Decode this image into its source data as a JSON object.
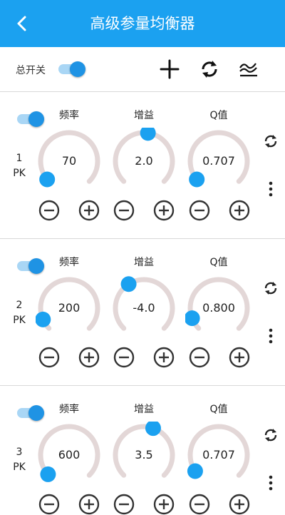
{
  "header": {
    "title": "高级参量均衡器"
  },
  "toolbar": {
    "master_label": "总开关",
    "master_on": true
  },
  "labels": {
    "freq": "频率",
    "gain": "增益",
    "q": "Q值"
  },
  "colors": {
    "accent": "#1ba1f0",
    "knob_dot": "#1ba1f0",
    "track": "#e3d7d7"
  },
  "bands": [
    {
      "index": "1",
      "type": "PK",
      "enabled": true,
      "freq": "70",
      "gain": "2.0",
      "q": "0.707",
      "freq_level": 0.02,
      "gain_level": 0.53,
      "q_level": 0.02
    },
    {
      "index": "2",
      "type": "PK",
      "enabled": true,
      "freq": "200",
      "gain": "-4.0",
      "q": "0.800",
      "freq_level": 0.08,
      "gain_level": 0.38,
      "q_level": 0.09
    },
    {
      "index": "3",
      "type": "PK",
      "enabled": true,
      "freq": "600",
      "gain": "3.5",
      "q": "0.707",
      "freq_level": 0.01,
      "gain_level": 0.57,
      "q_level": 0.04
    }
  ]
}
